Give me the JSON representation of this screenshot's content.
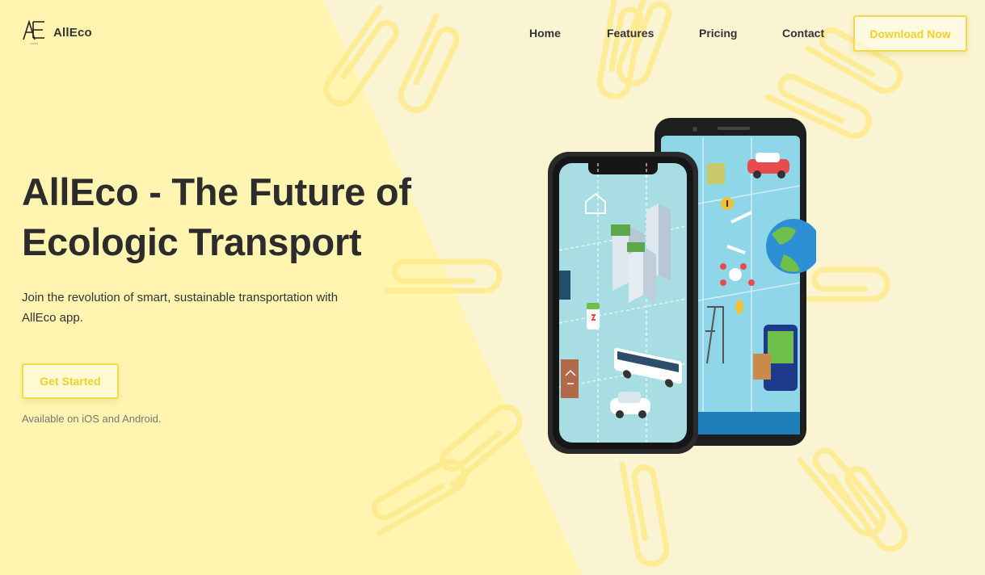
{
  "brand": {
    "logo_text": "AE",
    "name": "AllEco"
  },
  "nav": {
    "items": [
      {
        "label": "Home"
      },
      {
        "label": "Features"
      },
      {
        "label": "Pricing"
      },
      {
        "label": "Contact"
      }
    ],
    "download_label": "Download Now"
  },
  "hero": {
    "title": "AllEco - The Future of Ecologic Transport",
    "subtitle": "Join the revolution of smart, sustainable transportation with AllEco app.",
    "cta_label": "Get Started",
    "availability": "Available on iOS and Android."
  },
  "colors": {
    "accent": "#f5d94a",
    "background": "#fbf6d6",
    "triangle": "#fff4b3",
    "text": "#2c2c2c"
  },
  "icons": [
    "logo-mark-icon",
    "paperclip-icon",
    "phone-front-icon",
    "phone-back-icon"
  ]
}
